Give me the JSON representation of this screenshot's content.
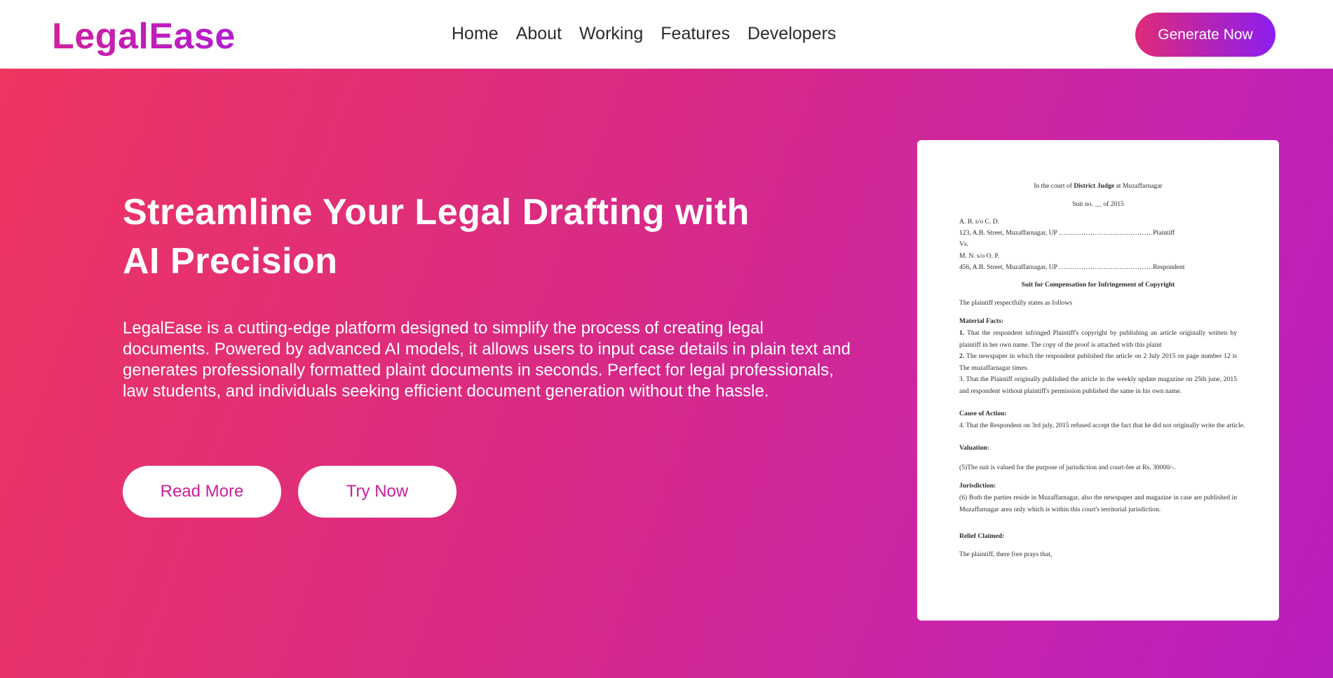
{
  "brand": {
    "name": "LegalEase"
  },
  "nav": {
    "items": [
      {
        "label": "Home"
      },
      {
        "label": "About"
      },
      {
        "label": "Working"
      },
      {
        "label": "Features"
      },
      {
        "label": "Developers"
      }
    ],
    "cta_label": "Generate Now"
  },
  "hero": {
    "title_line1": "Streamline Your Legal Drafting with",
    "title_line2": "AI Precision",
    "description": "LegalEase is a cutting-edge platform designed to simplify the process of creating legal documents. Powered by advanced AI models, it allows users to input case details in plain text and generates professionally formatted plaint documents in seconds. Perfect for legal professionals, law students, and individuals seeking efficient document generation without the hassle.",
    "read_more_label": "Read More",
    "try_now_label": "Try Now"
  },
  "document": {
    "court_prefix": "In the court of ",
    "court_judge": "District Judge",
    "court_suffix": " at Muzaffarnagar",
    "suit_no": "Suit no. __ of 2015",
    "plaintiff_name": "A. B. s/o C. D.",
    "plaintiff_address": "123, A.B. Street, Muzaffarnagar, UP ……………………………………Plaintiff",
    "versus": "Vs.",
    "respondent_name": "M. N. s/o O. P.",
    "respondent_address": "456, A.B. Street, Muzaffarnagar, UP ……………………………………Respondent",
    "suit_title": "Suit for Compensation for Infringement of Copyright",
    "intro": "The plaintiff respectfully states as follows",
    "material_facts_heading": "Material Facts:",
    "fact1_num": "1.",
    "fact1": " That the respondent infringed Plaintiff's copyright by publishing an article originally written by plaintiff in her own name. The copy of the proof is attached with this plaint",
    "fact2_num": "2.",
    "fact2": " The newspaper in which the respondent published the article on 2 July 2015 on page number 12 is The muzaffarnagar times.",
    "fact3": "3. That the Plaintiff originally published the article in the weekly update magazine on 25th june, 2015 and respondent without plaintiff's permission published the same in his own name.",
    "cause_heading": "Cause of Action:",
    "cause_text": "4. That the Respondent on 3rd july, 2015 refused accept the fact that he did not originally write the article.",
    "valuation_heading": "Valuation:",
    "valuation_text": "(5)The suit is valued for the purpose of jurisdiction and court-fee at Rs. 30000/-.",
    "jurisdiction_heading": "Jurisdiction:",
    "jurisdiction_text": "(6) Both the parties reside in Muzaffarnagar, also the newspaper and magazine in case are published in Muzaffarnagar area only which is within this court's territorial jurisdiction.",
    "relief_heading": "Relief Claimed:",
    "relief_text": "The plaintiff, there fore prays that,"
  }
}
